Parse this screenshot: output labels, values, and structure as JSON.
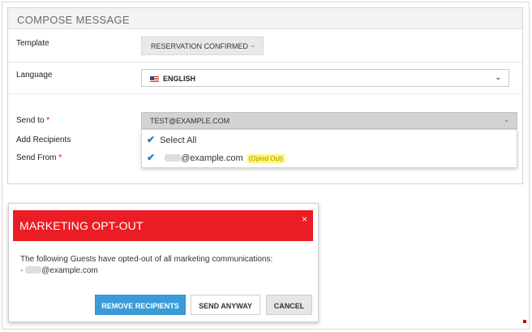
{
  "compose": {
    "title": "COMPOSE MESSAGE",
    "template_label": "Template",
    "template_value": "RESERVATION CONFIRMED",
    "language_label": "Language",
    "language_value": "ENGLISH",
    "send_to_label": "Send to",
    "add_recipients_label": "Add Recipients",
    "send_from_label": "Send From",
    "required_marker": "*",
    "send_to_value": "TEST@EXAMPLE.COM",
    "dropdown": {
      "select_all": "Select All",
      "recipient_email": "@example.com",
      "opted_out_tag": "(Opted Out)"
    }
  },
  "modal": {
    "title": "MARKETING OPT-OUT",
    "close_glyph": "×",
    "message_line1": "The following Guests have opted-out of all marketing communications:",
    "message_line2_prefix": "-",
    "message_email": "@example.com",
    "buttons": {
      "remove": "REMOVE RECIPIENTS",
      "send_anyway": "SEND ANYWAY",
      "cancel": "CANCEL"
    }
  },
  "icons": {
    "chevron_down": "⌄",
    "check": "✔"
  },
  "colors": {
    "modal_header": "#ec1c24",
    "primary_button": "#3a9bd9",
    "check": "#1e7bc8",
    "highlight": "#fbf97a"
  }
}
